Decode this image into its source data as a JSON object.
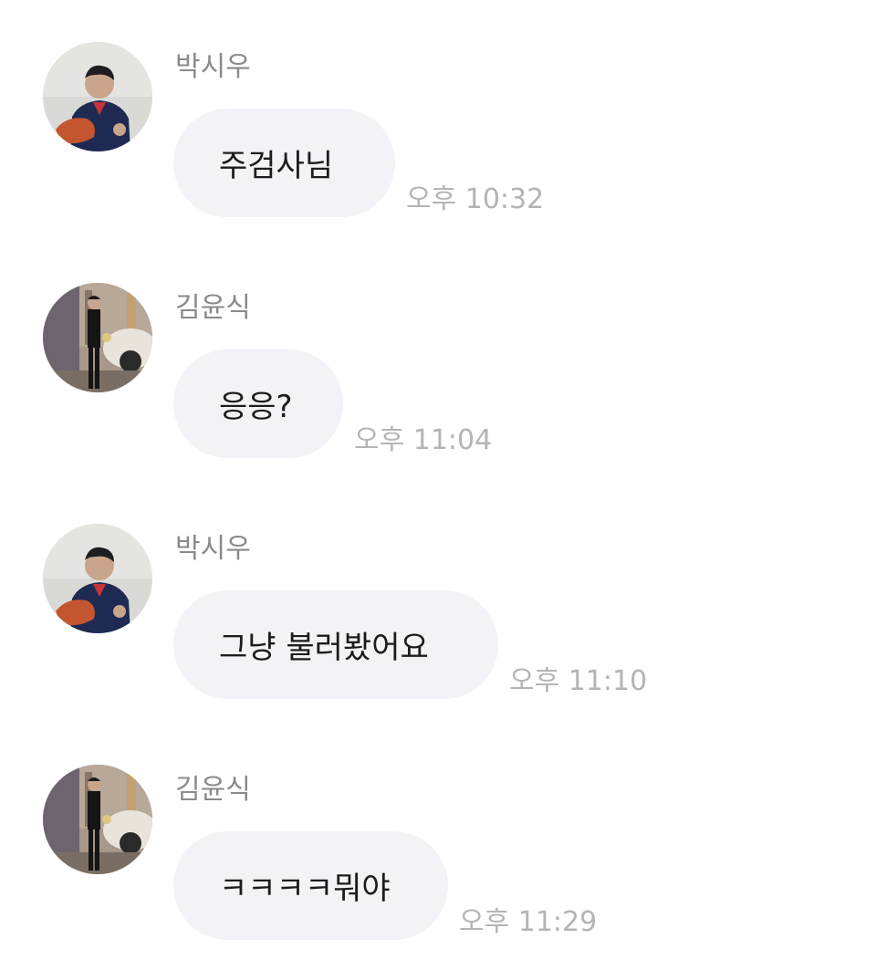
{
  "messages": [
    {
      "sender": "박시우",
      "text": "주검사님",
      "time": "오후 10:32",
      "avatar_icon": "person-photo-icon"
    },
    {
      "sender": "김윤식",
      "text": "응응?",
      "time": "오후 11:04",
      "avatar_icon": "person-photo-icon"
    },
    {
      "sender": "박시우",
      "text": "그냥 불러봤어요",
      "time": "오후 11:10",
      "avatar_icon": "person-photo-icon"
    },
    {
      "sender": "김윤식",
      "text": "ㅋㅋㅋㅋ뭐야",
      "time": "오후 11:29",
      "avatar_icon": "person-photo-icon"
    }
  ],
  "colors": {
    "background": "#ffffff",
    "bubble": "#f2f2f7",
    "message_text": "#1c1c1e",
    "sender_text": "#8a8a8e",
    "time_text": "#b4b4b8"
  }
}
